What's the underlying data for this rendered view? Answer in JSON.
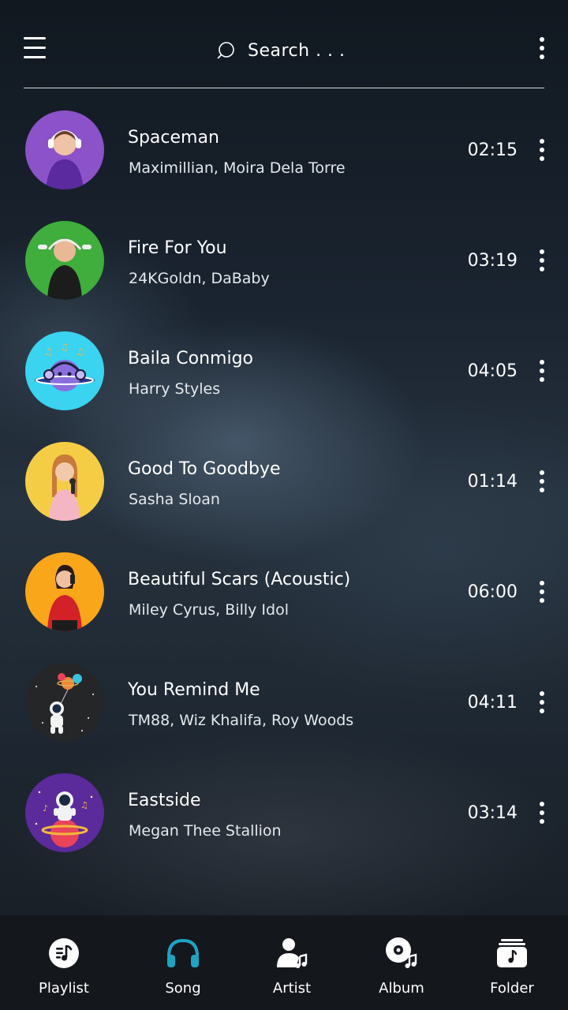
{
  "header": {
    "search_placeholder": "Search . . .",
    "menu_icon": "hamburger-menu-icon",
    "more_icon": "more-vertical-icon"
  },
  "songs": [
    {
      "title": "Spaceman",
      "artist": "Maximillian, Moira Dela Torre",
      "duration": "02:15",
      "art": "woman-headphones-purple"
    },
    {
      "title": "Fire For You",
      "artist": "24KGoldn, DaBaby",
      "duration": "03:19",
      "art": "woman-headphones-green"
    },
    {
      "title": "Baila Conmigo",
      "artist": "Harry Styles",
      "duration": "04:05",
      "art": "planet-headphones-cyan"
    },
    {
      "title": "Good To Goodbye",
      "artist": "Sasha Sloan",
      "duration": "01:14",
      "art": "girl-microphone-yellow"
    },
    {
      "title": "Beautiful Scars (Acoustic)",
      "artist": "Miley Cyrus, Billy Idol",
      "duration": "06:00",
      "art": "woman-phone-orange"
    },
    {
      "title": "You Remind Me",
      "artist": "TM88, Wiz Khalifa, Roy Woods",
      "duration": "04:11",
      "art": "astronaut-balloons-dark"
    },
    {
      "title": "Eastside",
      "artist": "Megan Thee Stallion",
      "duration": "03:14",
      "art": "astronaut-planet-purple"
    }
  ],
  "bottom_nav": [
    {
      "label": "Playlist",
      "icon": "playlist-icon",
      "active": false
    },
    {
      "label": "Song",
      "icon": "headphones-icon",
      "active": true
    },
    {
      "label": "Artist",
      "icon": "artist-icon",
      "active": false
    },
    {
      "label": "Album",
      "icon": "album-icon",
      "active": false
    },
    {
      "label": "Folder",
      "icon": "folder-icon",
      "active": false
    }
  ],
  "colors": {
    "accent": "#1fa3c4",
    "nav_background": "#14171c",
    "text": "#ffffff"
  }
}
